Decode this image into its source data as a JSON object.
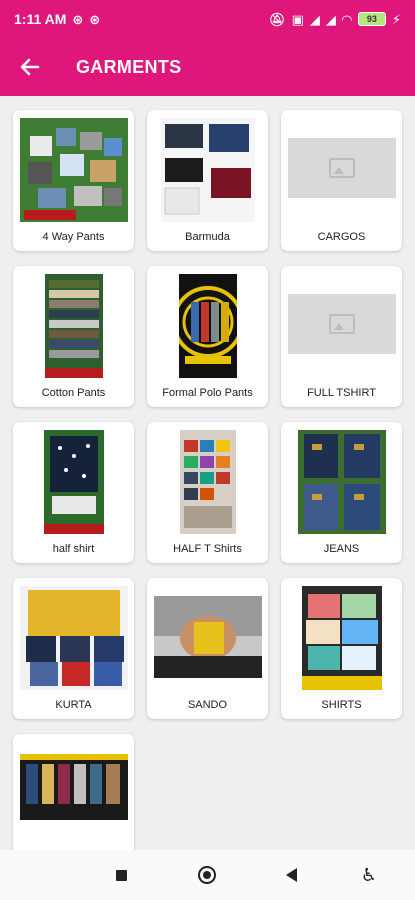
{
  "status_bar": {
    "time": "1:11 AM",
    "battery": "93"
  },
  "app_bar": {
    "title": "GARMENTS"
  },
  "categories": [
    {
      "label": "4 Way Pants",
      "image": "photo"
    },
    {
      "label": "Barmuda",
      "image": "photo"
    },
    {
      "label": "CARGOS",
      "image": "placeholder"
    },
    {
      "label": "Cotton Pants",
      "image": "photo"
    },
    {
      "label": "Formal Polo Pants",
      "image": "photo"
    },
    {
      "label": "FULL TSHIRT",
      "image": "placeholder"
    },
    {
      "label": "half shirt",
      "image": "photo"
    },
    {
      "label": "HALF T Shirts",
      "image": "photo"
    },
    {
      "label": "JEANS",
      "image": "photo"
    },
    {
      "label": "KURTA",
      "image": "photo"
    },
    {
      "label": "SANDO",
      "image": "photo"
    },
    {
      "label": "SHIRTS",
      "image": "photo"
    },
    {
      "label": "",
      "image": "photo"
    }
  ],
  "nav_bar": {
    "buttons": [
      "recent-apps",
      "home",
      "back",
      "accessibility"
    ]
  },
  "colors": {
    "primary": "#e0177a",
    "background": "#efefef"
  }
}
